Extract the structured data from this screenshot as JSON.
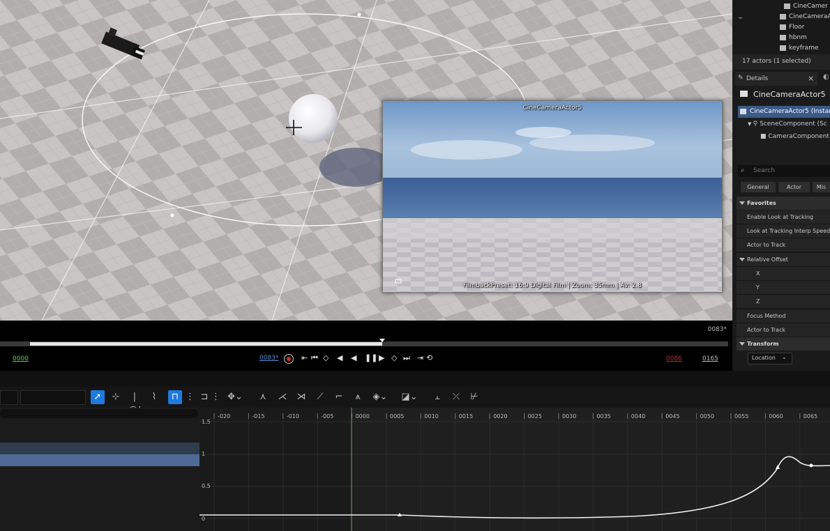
{
  "viewport": {
    "preview": {
      "camera_label": "CineCameraActor5",
      "info": "FilmbackPreset: 16:9 Digital Film | Zoom: 35mm | Av: 2.8"
    }
  },
  "timeline": {
    "current_frame_top": "0083*",
    "start_frame": "0000",
    "current_frame": "0083*",
    "end_marker": "0086",
    "end_frame": "0165",
    "progress": 0.5
  },
  "outliner": {
    "items": [
      {
        "label": "CineCamer",
        "icon": "camera-icon"
      },
      {
        "label": "CineCameraA",
        "icon": "camera-icon"
      },
      {
        "label": "Floor",
        "icon": "cube-icon"
      },
      {
        "label": "hbnm",
        "icon": "cube-icon"
      },
      {
        "label": "keyframe",
        "icon": "cube-icon"
      }
    ],
    "status": "17 actors (1 selected)"
  },
  "details": {
    "tab_label": "Details",
    "close": "×",
    "actor_name": "CineCameraActor5",
    "components": [
      {
        "label": "CineCameraActor5 (Instar"
      },
      {
        "label": "SceneComponent (Sc"
      },
      {
        "label": "CameraComponent"
      }
    ],
    "search_placeholder": "Search",
    "filter_tabs": [
      "General",
      "Actor",
      "Mis"
    ],
    "categories": {
      "favorites": "Favorites",
      "relative_offset": "Relative Offset",
      "transform": "Transform"
    },
    "properties": {
      "enable_look": "Enable Look at Tracking",
      "look_interp": "Look at Tracking Interp Speed",
      "actor_to_track_1": "Actor to Track",
      "x": "X",
      "y": "Y",
      "z": "Z",
      "focus_method": "Focus Method",
      "actor_to_track_2": "Actor to Track"
    },
    "location_dropdown": "Location"
  },
  "curve_editor": {
    "y_labels": [
      "1.5",
      "1",
      "0.5",
      "0"
    ],
    "x_ticks": [
      "-020",
      "-015",
      "-010",
      "-005",
      "0000",
      "0005",
      "0010",
      "0015",
      "0020",
      "0025",
      "0030",
      "0035",
      "0040",
      "0045",
      "0050",
      "0055",
      "0060",
      "0065"
    ]
  }
}
